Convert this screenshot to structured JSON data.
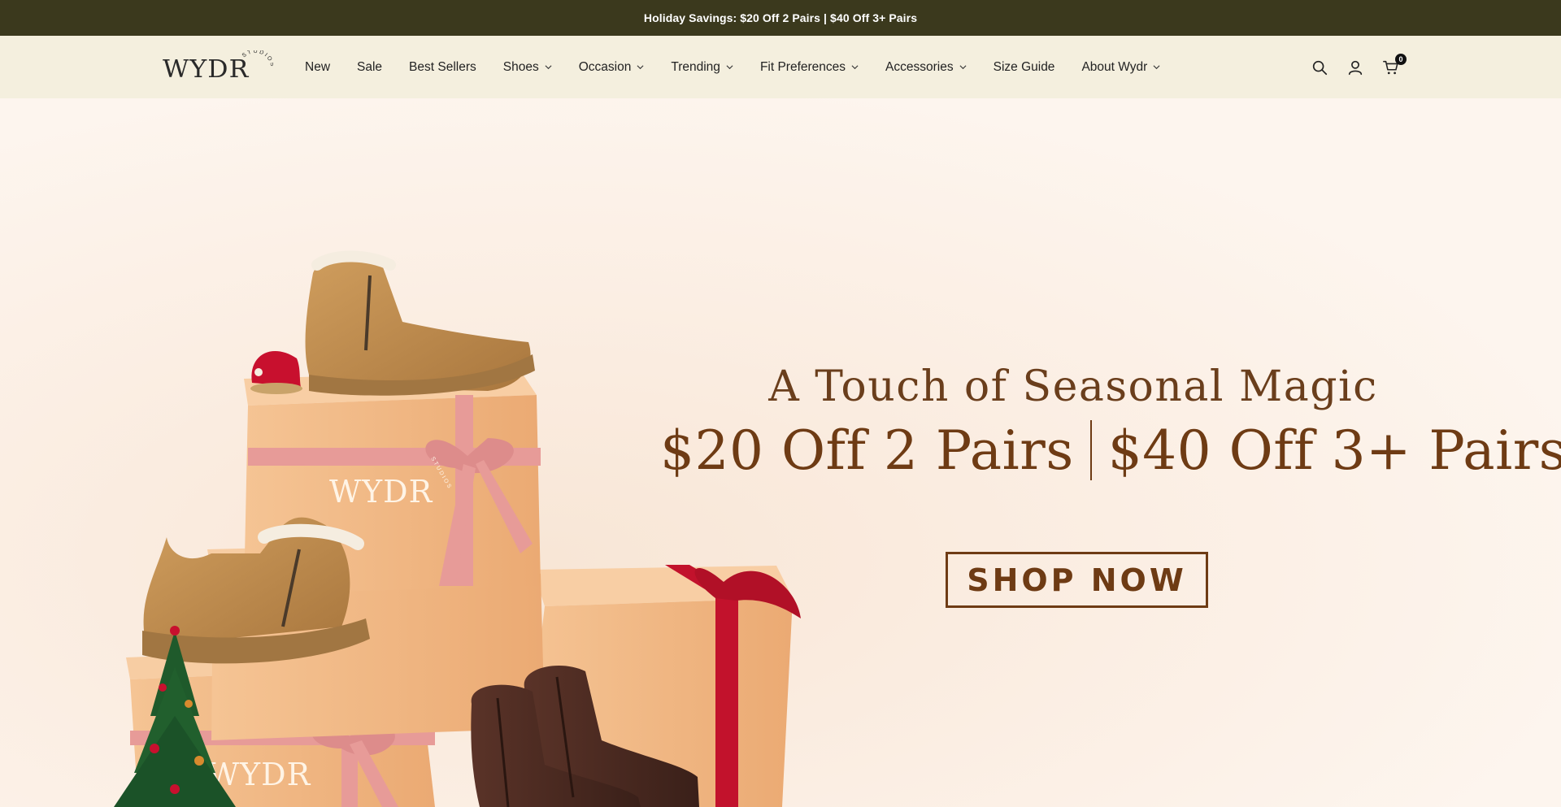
{
  "announcement": {
    "text": "Holiday Savings: $20 Off 2 Pairs | $40 Off 3+ Pairs"
  },
  "header": {
    "logo": {
      "wordmark": "WYDR",
      "submark": "STUDIOS"
    },
    "nav": [
      {
        "label": "New",
        "has_dropdown": false
      },
      {
        "label": "Sale",
        "has_dropdown": false
      },
      {
        "label": "Best Sellers",
        "has_dropdown": false
      },
      {
        "label": "Shoes",
        "has_dropdown": true
      },
      {
        "label": "Occasion",
        "has_dropdown": true
      },
      {
        "label": "Trending",
        "has_dropdown": true
      },
      {
        "label": "Fit Preferences",
        "has_dropdown": true
      },
      {
        "label": "Accessories",
        "has_dropdown": true
      },
      {
        "label": "Size Guide",
        "has_dropdown": false
      },
      {
        "label": "About Wydr",
        "has_dropdown": true
      }
    ],
    "icons": [
      "search-icon",
      "account-icon",
      "cart-icon"
    ],
    "cart_count": "0"
  },
  "hero": {
    "tagline": "A Touch of Seasonal Magic",
    "offer_left": "$20 Off 2 Pairs",
    "offer_right": "$40 Off 3+ Pairs",
    "cta": "SHOP NOW",
    "box_print": "WYDR",
    "box_print_sub": "STUDIOS"
  },
  "colors": {
    "announcement_bg": "#3b391d",
    "header_bg": "#f4efde",
    "hero_bg": "#fdf4ec",
    "brand_brown": "#6e3b14",
    "box": "#f2b987",
    "ribbon_pink": "#e79b98",
    "ribbon_red": "#c2122c",
    "suede": "#c2904f",
    "leather": "#4a2a22"
  }
}
